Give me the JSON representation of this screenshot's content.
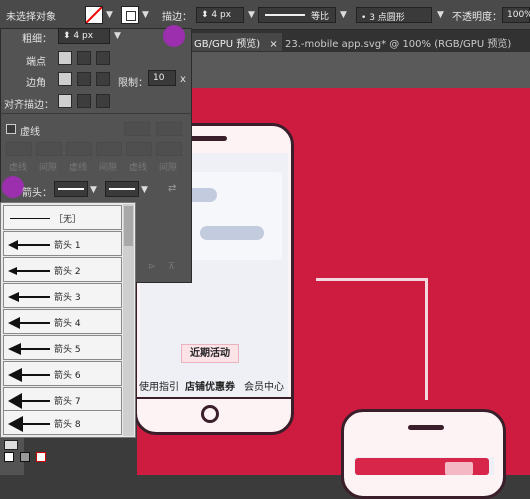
{
  "control_bar": {
    "no_selection": "未选择对象",
    "stroke_label": "描边：",
    "stroke_value": "4 px",
    "profile_label": "等比",
    "brush_label": "3 点圆形",
    "opacity_label": "不透明度：",
    "opacity_value": "100%"
  },
  "tabs": {
    "active": "GB/GPU 预览)",
    "close": "×",
    "second": "23.-mobile app.svg* @ 100% (RGB/GPU 预览)"
  },
  "stroke_panel": {
    "weight_label": "粗细：",
    "weight_value": "4 px",
    "cap_label": "端点",
    "corner_label": "边角",
    "limit_label": "限制：",
    "limit_value": "10",
    "limit_unit": "x",
    "align_label": "对齐描边：",
    "dashed_label": "虚线",
    "dash_labels": [
      "虚线",
      "间隙",
      "虚线",
      "间隙",
      "虚线",
      "间隙"
    ],
    "arrow_label": "箭头："
  },
  "arrow_options": [
    {
      "label": "［无］"
    },
    {
      "label": "箭头 1"
    },
    {
      "label": "箭头 2"
    },
    {
      "label": "箭头 3"
    },
    {
      "label": "箭头 4"
    },
    {
      "label": "箭头 5"
    },
    {
      "label": "箭头 6"
    },
    {
      "label": "箭头 7"
    },
    {
      "label": "箭头 8"
    }
  ],
  "artboard": {
    "button": "近期活动",
    "nav": [
      "使用指引",
      "店铺优惠券",
      "会员中心"
    ]
  },
  "colors": {
    "canvas": "#cd1c40",
    "marker": "#9b2fae",
    "phone_outline": "#3a1f2a"
  }
}
